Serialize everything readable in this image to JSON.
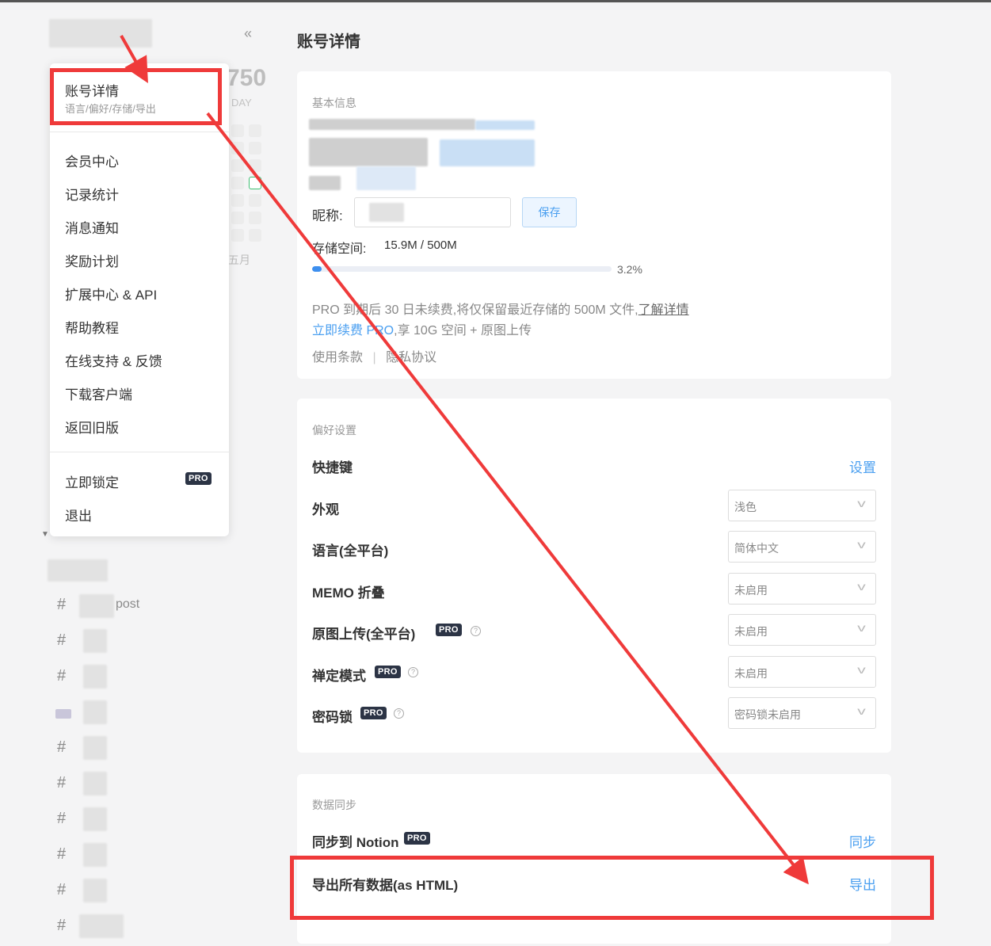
{
  "sidebar": {
    "stat_number": "750",
    "stat_label": "DAY",
    "month_label": "五月",
    "tag_partial": "post"
  },
  "menu": {
    "account": {
      "label": "账号详情",
      "sub": "语言/偏好/存储/导出"
    },
    "items": [
      "会员中心",
      "记录统计",
      "消息通知",
      "奖励计划",
      "扩展中心 & API",
      "帮助教程",
      "在线支持 & 反馈",
      "下载客户端",
      "返回旧版"
    ],
    "lock_label": "立即锁定",
    "logout_label": "退出",
    "pro_badge": "PRO"
  },
  "main": {
    "title": "账号详情",
    "basic": {
      "section": "基本信息",
      "nickname_label": "昵称:",
      "save_label": "保存",
      "storage_label": "存储空间:",
      "storage_value": "15.9M / 500M",
      "storage_percent": "3.2%",
      "storage_fraction": 0.032,
      "notice_line1": "PRO 到期后 30 日未续费,将仅保留最近存储的 500M 文件,",
      "notice_link": "了解详情",
      "renew_link": "立即续费 PRO",
      "renew_text": ",享 10G 空间 + 原图上传",
      "terms": "使用条款",
      "separator": "|",
      "privacy": "隐私协议"
    },
    "prefs": {
      "section": "偏好设置",
      "shortcut_label": "快捷键",
      "shortcut_link": "设置",
      "rows": [
        {
          "label": "外观",
          "value": "浅色",
          "pro": false,
          "help": false
        },
        {
          "label": "语言(全平台)",
          "value": "简体中文",
          "pro": false,
          "help": false
        },
        {
          "label": "MEMO 折叠",
          "value": "未启用",
          "pro": false,
          "help": false
        },
        {
          "label": "原图上传(全平台)",
          "value": "未启用",
          "pro": true,
          "help": true
        },
        {
          "label": "禅定模式",
          "value": "未启用",
          "pro": true,
          "help": true
        },
        {
          "label": "密码锁",
          "value": "密码锁未启用",
          "pro": true,
          "help": true
        }
      ]
    },
    "sync": {
      "section": "数据同步",
      "notion_label": "同步到 Notion",
      "notion_link": "同步",
      "export_label": "导出所有数据(as HTML)",
      "export_link": "导出"
    }
  },
  "colors": {
    "annotation": "#ef3a3a",
    "link": "#4a9ff0",
    "pro_badge": "#2c3445",
    "progress": "#3d8fef"
  }
}
